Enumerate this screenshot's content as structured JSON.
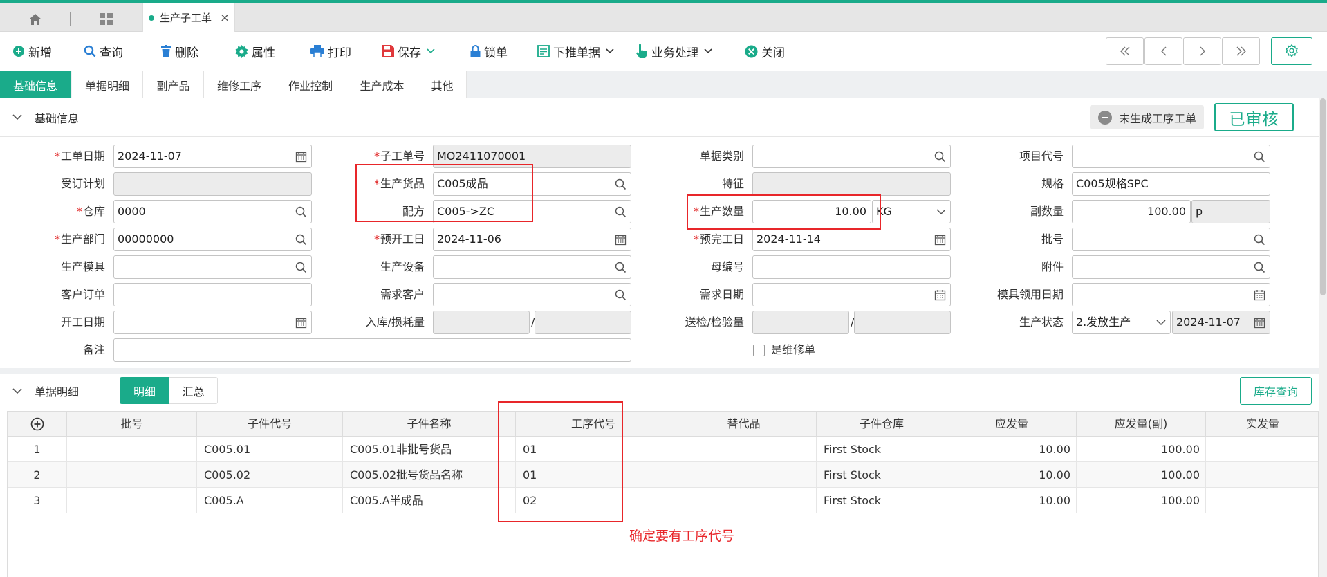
{
  "tabs": {
    "active_label": "生产子工单",
    "close_symbol": "×"
  },
  "toolbar": {
    "add": "新增",
    "query": "查询",
    "delete": "删除",
    "properties": "属性",
    "print": "打印",
    "save": "保存",
    "lock": "锁单",
    "push_down": "下推单据",
    "business": "业务处理",
    "close": "关闭"
  },
  "subtabs": [
    "基础信息",
    "单据明细",
    "副产品",
    "维修工序",
    "作业控制",
    "生产成本",
    "其他"
  ],
  "basic": {
    "title": "基础信息",
    "status_badge": "未生成工序工单",
    "approved": "已审核",
    "fields": {
      "order_date": {
        "label": "工单日期",
        "value": "2024-11-07"
      },
      "sub_order_no": {
        "label": "子工单号",
        "value": "MO2411070001"
      },
      "doc_category": {
        "label": "单据类别",
        "value": ""
      },
      "project_code": {
        "label": "项目代号",
        "value": ""
      },
      "order_plan": {
        "label": "受订计划",
        "value": ""
      },
      "product_goods": {
        "label": "生产货品",
        "value": "C005成品"
      },
      "feature": {
        "label": "特征",
        "value": ""
      },
      "spec": {
        "label": "规格",
        "value": "C005规格SPC"
      },
      "warehouse": {
        "label": "仓库",
        "value": "0000"
      },
      "recipe": {
        "label": "配方",
        "value": "C005->ZC"
      },
      "prod_qty": {
        "label": "生产数量",
        "value": "10.00",
        "unit": "KG"
      },
      "sub_qty": {
        "label": "副数量",
        "value": "100.00",
        "unit": "p"
      },
      "prod_dept": {
        "label": "生产部门",
        "value": "00000000"
      },
      "plan_start": {
        "label": "预开工日",
        "value": "2024-11-06"
      },
      "plan_finish": {
        "label": "预完工日",
        "value": "2024-11-14"
      },
      "batch_no": {
        "label": "批号",
        "value": ""
      },
      "mold": {
        "label": "生产模具",
        "value": ""
      },
      "equipment": {
        "label": "生产设备",
        "value": ""
      },
      "parent_no": {
        "label": "母编号",
        "value": ""
      },
      "attachment": {
        "label": "附件",
        "value": ""
      },
      "customer_order": {
        "label": "客户订单",
        "value": ""
      },
      "demand_customer": {
        "label": "需求客户",
        "value": ""
      },
      "demand_date": {
        "label": "需求日期",
        "value": ""
      },
      "mold_date": {
        "label": "模具领用日期",
        "value": ""
      },
      "start_date": {
        "label": "开工日期",
        "value": ""
      },
      "in_loss": {
        "label": "入库/损耗量",
        "value": ""
      },
      "inspect_qty": {
        "label": "送检/检验量",
        "value": ""
      },
      "prod_status": {
        "label": "生产状态",
        "value": "2.发放生产",
        "date": "2024-11-07"
      },
      "remark": {
        "label": "备注",
        "value": ""
      },
      "is_repair": {
        "label": "是维修单"
      }
    },
    "slash": "/"
  },
  "detail": {
    "title": "单据明细",
    "seg_detail": "明细",
    "seg_summary": "汇总",
    "stock_query": "库存查询",
    "columns": [
      "批号",
      "子件代号",
      "子件名称",
      "工序代号",
      "替代品",
      "子件仓库",
      "应发量",
      "应发量(副)",
      "实发量"
    ],
    "rows": [
      {
        "idx": "1",
        "batch": "",
        "code": "C005.01",
        "name": "C005.01非批号货品",
        "process": "01",
        "sub": "",
        "wh": "First Stock",
        "qty": "10.00",
        "qty2": "100.00",
        "actual": ""
      },
      {
        "idx": "2",
        "batch": "",
        "code": "C005.02",
        "name": "C005.02批号货品名称",
        "process": "01",
        "sub": "",
        "wh": "First Stock",
        "qty": "10.00",
        "qty2": "100.00",
        "actual": ""
      },
      {
        "idx": "3",
        "batch": "",
        "code": "C005.A",
        "name": "C005.A半成品",
        "process": "02",
        "sub": "",
        "wh": "First Stock",
        "qty": "10.00",
        "qty2": "100.00",
        "actual": ""
      }
    ]
  },
  "annotation": "确定要有工序代号",
  "colors": {
    "accent": "#1aab8a",
    "required": "#e02020",
    "highlight": "#e8262a"
  }
}
